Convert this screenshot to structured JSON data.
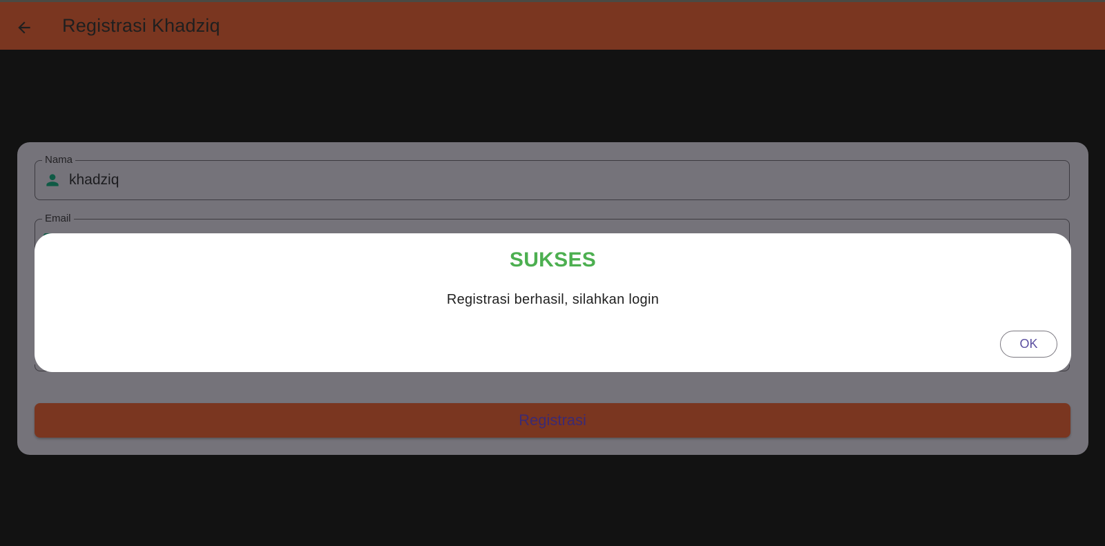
{
  "appbar": {
    "title": "Registrasi Khadziq",
    "back_icon": "arrow-left-icon",
    "color": "#7a3620"
  },
  "form": {
    "name_field": {
      "label": "Nama",
      "value": "khadziq",
      "icon": "person-icon"
    },
    "email_field": {
      "label": "Email",
      "icon": "email-icon"
    },
    "register_button": {
      "label": "Registrasi"
    }
  },
  "dialog": {
    "title": "SUKSES",
    "message": "Registrasi berhasil, silahkan login",
    "ok_label": "OK",
    "title_color": "#4caf50"
  }
}
